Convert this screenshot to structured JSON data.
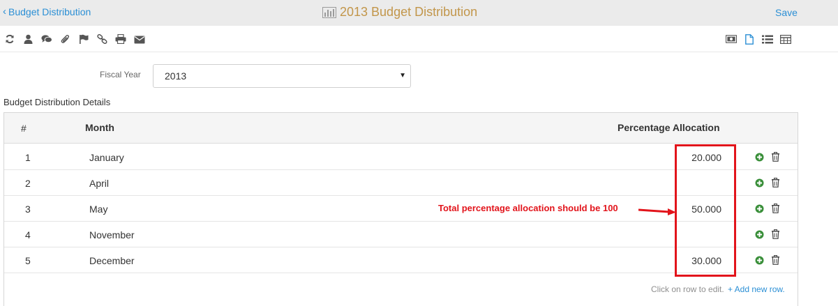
{
  "header": {
    "back_label": "Budget Distribution",
    "title": "2013 Budget Distribution",
    "save_label": "Save"
  },
  "toolbar": {
    "left_icons": [
      "refresh-icon",
      "user-icon",
      "comments-icon",
      "paperclip-icon",
      "flag-icon",
      "link-icon",
      "print-icon",
      "envelope-icon"
    ],
    "right_icons": [
      "money-icon",
      "document-icon",
      "list-icon",
      "table-icon"
    ]
  },
  "form": {
    "fiscal_year_label": "Fiscal Year",
    "fiscal_year_value": "2013"
  },
  "section": {
    "title": "Budget Distribution Details"
  },
  "table": {
    "headers": {
      "num": "#",
      "month": "Month",
      "percentage": "Percentage Allocation"
    },
    "rows": [
      {
        "num": "1",
        "month": "January",
        "percentage": "20.000"
      },
      {
        "num": "2",
        "month": "April",
        "percentage": ""
      },
      {
        "num": "3",
        "month": "May",
        "percentage": "50.000"
      },
      {
        "num": "4",
        "month": "November",
        "percentage": ""
      },
      {
        "num": "5",
        "month": "December",
        "percentage": "30.000"
      }
    ],
    "footer_hint": "Click on row to edit.",
    "add_row_label": "+ Add new row."
  },
  "annotation": {
    "text": "Total percentage allocation should be 100",
    "color": "#e2141b"
  },
  "colors": {
    "link": "#2b8fd5",
    "title": "#c2964a",
    "add_icon": "#3a8f3a",
    "header_bg": "#ebebeb"
  }
}
